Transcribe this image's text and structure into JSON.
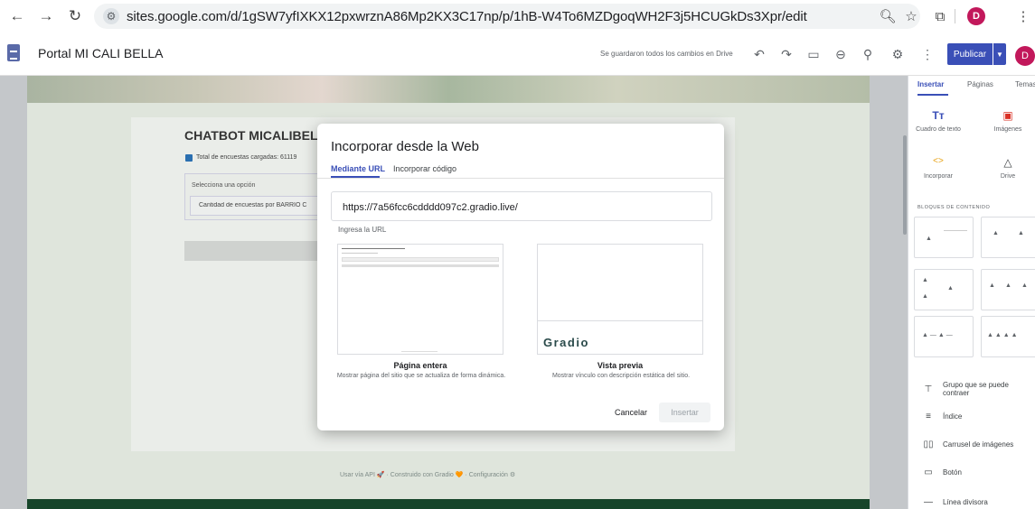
{
  "browser": {
    "url": "sites.google.com/d/1gSW7yfIXKX12pxwrznA86Mp2KX3C17np/p/1hB-W4To6MZDgoqWH2F3j5HCUGkDs3Xpr/edit",
    "profile_initial": "D"
  },
  "header": {
    "site_title": "Portal MI CALI BELLA",
    "save_status": "Se guardaron todos los cambios en Drive",
    "publish_label": "Publicar",
    "avatar_initial": "D"
  },
  "page": {
    "title": "CHATBOT MICALIBELL",
    "survey_count": "Total de encuestas cargadas: 61119",
    "select_label": "Selecciona una opción",
    "select_value": "Cantidad de encuestas por BARRIO C",
    "footer": "Usar vía API 🚀 · Construido con Gradio 🧡 · Configuración ⚙"
  },
  "dialog": {
    "title": "Incorporar desde la Web",
    "tab_url": "Mediante URL",
    "tab_code": "Incorporar código",
    "url_value": "https://7a56fcc6cdddd097c2.gradio.live/",
    "url_hint": "Ingresa la URL",
    "preview_brand": "Gradio",
    "full_caption": "Página entera",
    "full_desc": "Mostrar página del sitio que se actualiza de forma dinámica.",
    "preview_caption": "Vista previa",
    "preview_desc": "Mostrar vínculo con descripción estática del sitio.",
    "cancel_label": "Cancelar",
    "insert_label": "Insertar"
  },
  "sidebar": {
    "tabs": [
      "Insertar",
      "Páginas",
      "Temas"
    ],
    "tiles": [
      {
        "label": "Cuadro de texto",
        "glyph": "Tт"
      },
      {
        "label": "Imágenes",
        "glyph": "▣"
      },
      {
        "label": "Incorporar",
        "glyph": "<>"
      },
      {
        "label": "Drive",
        "glyph": "△"
      }
    ],
    "blocks_title": "BLOQUES DE CONTENIDO",
    "items": [
      {
        "label": "Grupo que se puede contraer",
        "glyph": "⊤"
      },
      {
        "label": "Índice",
        "glyph": "≡"
      },
      {
        "label": "Carrusel de imágenes",
        "glyph": "▯▯"
      },
      {
        "label": "Botón",
        "glyph": "▭"
      },
      {
        "label": "Línea divisora",
        "glyph": "—"
      }
    ]
  }
}
